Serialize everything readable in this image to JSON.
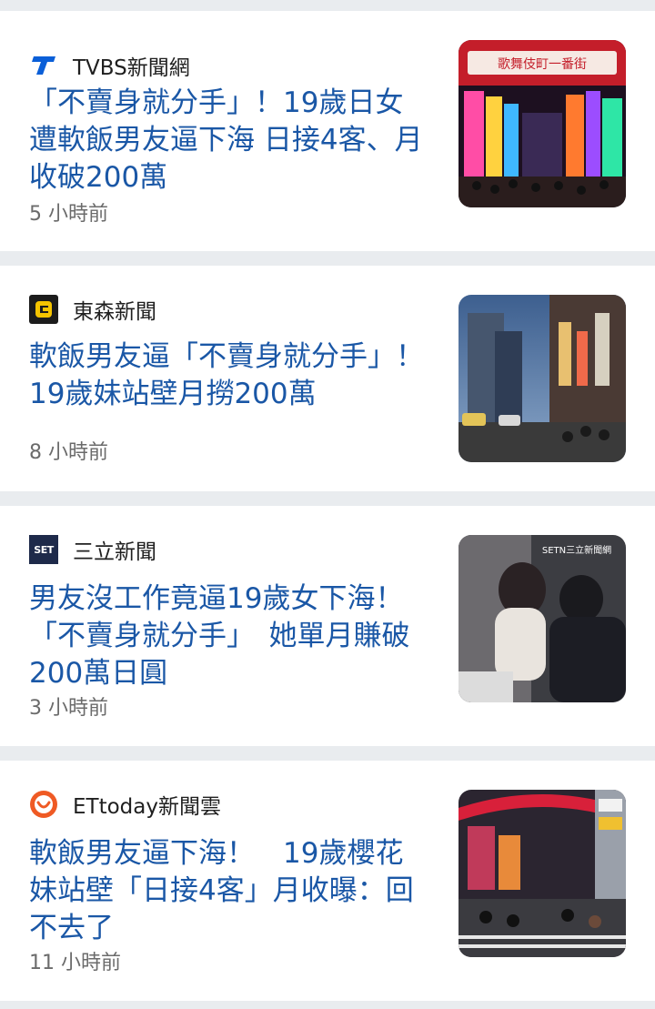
{
  "articles": [
    {
      "source": "TVBS新聞網",
      "logo": "tvbs-logo-icon",
      "headline": "「不賣身就分手」！19歲日女遭軟飯男友逼下海 日接4客、月收破200萬",
      "time": "5 小時前",
      "thumbnail": "kabukicho-gate-photo",
      "sign_text": "歌舞伎町一番街"
    },
    {
      "source": "東森新聞",
      "logo": "ebc-logo-icon",
      "headline": "軟飯男友逼「不賣身就分手」！19歲妹站壁月撈200萬",
      "time": "8 小時前",
      "thumbnail": "tokyo-street-dusk-photo"
    },
    {
      "source": "三立新聞",
      "logo": "set-logo-icon",
      "logo_text": "SET",
      "headline": "男友沒工作竟逼19歲女下海！「不賣身就分手」　她單月賺破200萬日圓",
      "time": "3 小時前",
      "thumbnail": "couple-scene-photo",
      "watermark": "SETN三立新聞網"
    },
    {
      "source": "ETtoday新聞雲",
      "logo": "ettoday-logo-icon",
      "headline": "軟飯男友逼下海！　19歲櫻花妹站壁「日接4客」月收曝：回不去了",
      "time": "11 小時前",
      "thumbnail": "kabukicho-crosswalk-photo"
    }
  ]
}
